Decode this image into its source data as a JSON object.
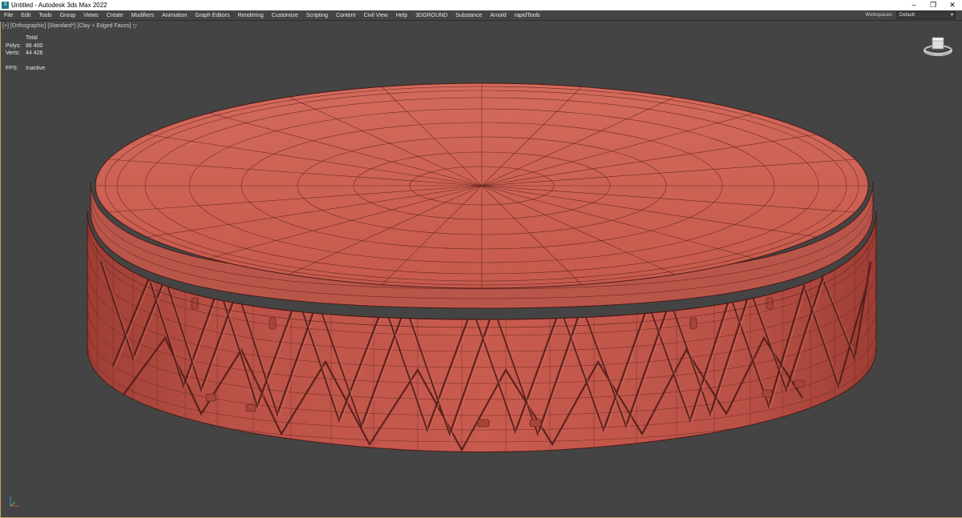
{
  "window": {
    "title": "Untitled - Autodesk 3ds Max 2022",
    "controls": {
      "minimize": "–",
      "maximize": "❐",
      "close": "✕"
    }
  },
  "menu": {
    "items": [
      "File",
      "Edit",
      "Tools",
      "Group",
      "Views",
      "Create",
      "Modifiers",
      "Animation",
      "Graph Editors",
      "Rendering",
      "Customize",
      "Scripting",
      "Content",
      "Civil View",
      "Help",
      "3DGROUND",
      "Substance",
      "Arnold",
      "rapidTools"
    ],
    "workspace_label": "Workspaces:",
    "workspace_value": "Default"
  },
  "viewport": {
    "label_parts": [
      "[+]",
      "[Orthographic]",
      "[Standard*]",
      "[Clay + Edged Faces]"
    ],
    "filter_icon": "▽",
    "stats": {
      "header": "Total",
      "polys_label": "Polys:",
      "polys_value": "86 400",
      "verts_label": "Verts:",
      "verts_value": "44 426",
      "fps_label": "FPS:",
      "fps_value": "Inactive"
    }
  },
  "colors": {
    "viewport_bg": "#444444",
    "clay": "#c75a4e",
    "clay_dark": "#a8443a",
    "wire": "#4a1a16",
    "active_border": "#caa45a"
  },
  "icons": {
    "app": "3ds-max-icon",
    "viewcube": "viewcube-icon",
    "axis": "axis-tripod-icon",
    "filter": "filter-icon"
  }
}
